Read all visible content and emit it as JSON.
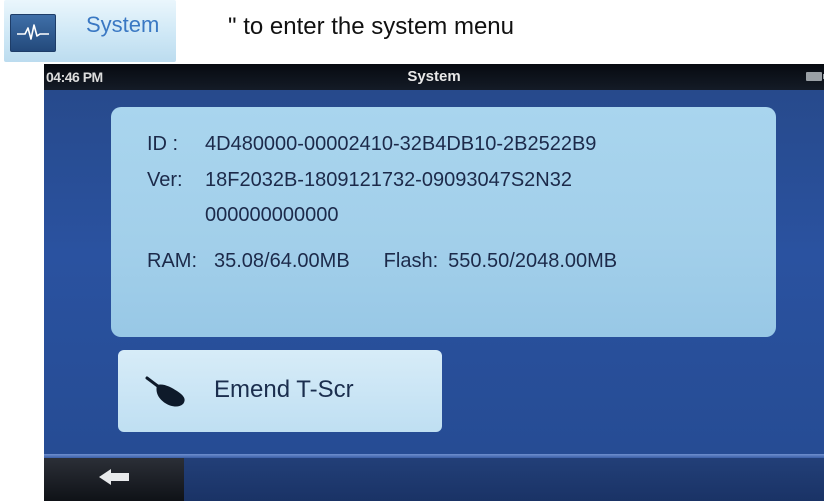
{
  "instruction": {
    "chip_label": "System",
    "chip_icon": "heartbeat-monitor-icon",
    "text": "\" to enter the system menu"
  },
  "status": {
    "time": "04:46 PM",
    "title": "System",
    "battery_icon": "battery-icon"
  },
  "info": {
    "id_label": "ID :",
    "id_value": "4D480000-00002410-32B4DB10-2B2522B9",
    "ver_label": "Ver:",
    "ver_value_line1": "18F2032B-1809121732-09093047S2N32",
    "ver_value_line2": "000000000000",
    "ram_label": "RAM:",
    "ram_value": "35.08/64.00MB",
    "flash_label": "Flash:",
    "flash_value": "550.50/2048.00MB"
  },
  "buttons": {
    "emend_label": "Emend T-Scr",
    "emend_icon": "stylus-hand-icon",
    "back_icon": "back-arrow-icon"
  },
  "colors": {
    "screen_bg": "#2a52a0",
    "panel_bg": "#a2cfea",
    "statusbar_bg": "#0b0f16"
  }
}
